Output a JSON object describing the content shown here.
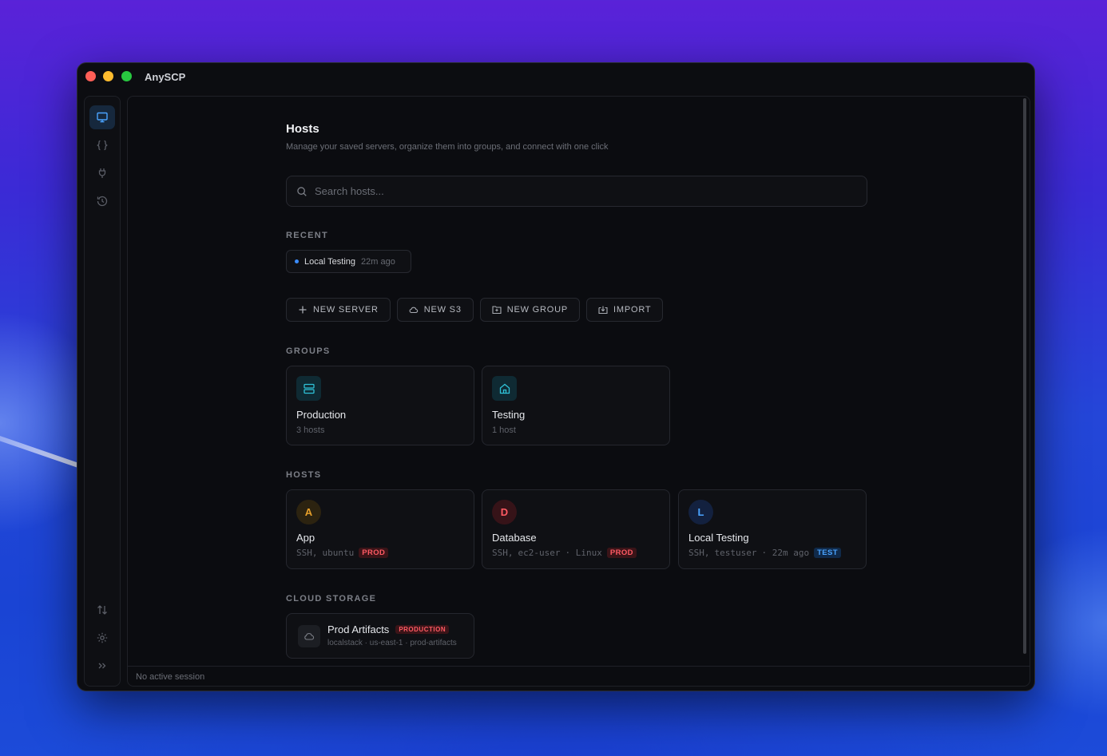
{
  "app": {
    "title": "AnySCP"
  },
  "sidebar": {
    "items": [
      {
        "name": "hosts",
        "icon": "monitor-icon",
        "active": true
      },
      {
        "name": "snippets",
        "icon": "braces-icon",
        "active": false
      },
      {
        "name": "connections",
        "icon": "plug-icon",
        "active": false
      },
      {
        "name": "history",
        "icon": "history-icon",
        "active": false
      }
    ],
    "bottom_items": [
      {
        "name": "transfers",
        "icon": "transfer-arrows-icon"
      },
      {
        "name": "settings",
        "icon": "gear-icon"
      },
      {
        "name": "expand",
        "icon": "chevrons-right-icon"
      }
    ]
  },
  "page": {
    "title": "Hosts",
    "subtitle": "Manage your saved servers, organize them into groups, and connect with one click"
  },
  "search": {
    "placeholder": "Search hosts..."
  },
  "recent": {
    "label": "RECENT",
    "items": [
      {
        "name": "Local Testing",
        "time": "22m ago"
      }
    ]
  },
  "actions": [
    {
      "label": "NEW SERVER",
      "icon": "plus-icon"
    },
    {
      "label": "NEW S3",
      "icon": "cloud-icon"
    },
    {
      "label": "NEW GROUP",
      "icon": "folder-plus-icon"
    },
    {
      "label": "IMPORT",
      "icon": "import-icon"
    }
  ],
  "groups": {
    "label": "GROUPS",
    "items": [
      {
        "name": "Production",
        "count": "3 hosts",
        "icon": "server-icon"
      },
      {
        "name": "Testing",
        "count": "1 host",
        "icon": "home-icon"
      }
    ]
  },
  "hosts": {
    "label": "HOSTS",
    "items": [
      {
        "initial": "A",
        "name": "App",
        "protocol": "SSH,",
        "user": "ubuntu",
        "extra": "",
        "badge": "PROD",
        "color": "#e7a02a"
      },
      {
        "initial": "D",
        "name": "Database",
        "protocol": "SSH,",
        "user": "ec2-user",
        "extra": "· Linux",
        "badge": "PROD",
        "color": "#ff5a63"
      },
      {
        "initial": "L",
        "name": "Local Testing",
        "protocol": "SSH,",
        "user": "testuser",
        "extra": "· 22m ago",
        "badge": "TEST",
        "color": "#4aa3ff"
      }
    ]
  },
  "cloud_storage": {
    "label": "CLOUD STORAGE",
    "items": [
      {
        "name": "Prod Artifacts",
        "badge": "PRODUCTION",
        "details": "localstack · us-east-1 · prod-artifacts",
        "icon": "cloud-icon"
      }
    ]
  },
  "status": {
    "text": "No active session"
  }
}
